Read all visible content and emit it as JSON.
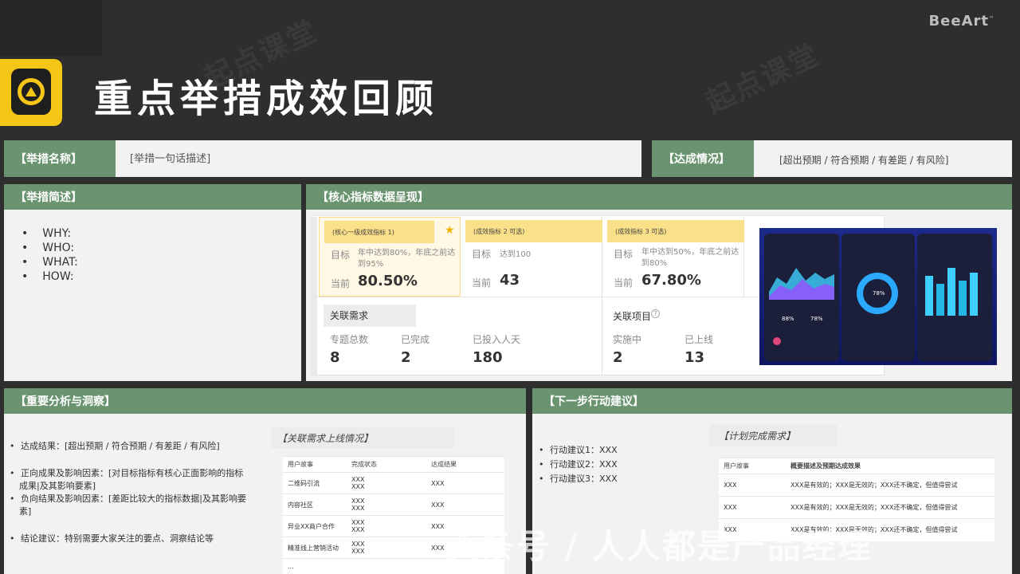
{
  "brand": "BeeArt",
  "brand_mark": "™",
  "page_title": "重点举措成效回顾",
  "top": {
    "name_label": "【举措名称】",
    "name_value": "[举措一句话描述]",
    "status_label": "【达成情况】",
    "status_value": "[超出预期 / 符合预期 / 有差距 / 有风险]"
  },
  "summary": {
    "title": "【举措简述】",
    "items": [
      "WHY:",
      "WHO:",
      "WHAT:",
      "HOW:"
    ]
  },
  "metrics": {
    "title": "【核心指标数据呈现】",
    "cards": [
      {
        "tag": "(核心一级成效指标 1)",
        "target_label": "目标",
        "target": "年中达到80%，年底之前达到95%",
        "current_label": "当前",
        "current": "80.50%"
      },
      {
        "tag": "(成效指标 2 可选)",
        "target_label": "目标",
        "target": "达到100",
        "current_label": "当前",
        "current": "43"
      },
      {
        "tag": "(成效指标 3 可选)",
        "target_label": "目标",
        "target": "年中达到50%，年底之前达到80%",
        "current_label": "当前",
        "current": "67.80%"
      }
    ],
    "related_demand": {
      "title": "关联需求",
      "stats": [
        {
          "label": "专题总数",
          "value": "8"
        },
        {
          "label": "已完成",
          "value": "2"
        },
        {
          "label": "已投入人天",
          "value": "180"
        }
      ]
    },
    "related_project": {
      "title": "关联项目",
      "stats": [
        {
          "label": "实施中",
          "value": "2"
        },
        {
          "label": "已上线",
          "value": "13"
        }
      ]
    },
    "phone_values": [
      "88%",
      "78%",
      "78%"
    ]
  },
  "analysis": {
    "title": "【重要分析与洞察】",
    "points": [
      "达成结果：[超出预期 / 符合预期 / 有差距 / 有风险]",
      "正向成果及影响因素：[对目标指标有核心正面影响的指标成果|及其影响要素]",
      "负向结果及影响因素：[差距比较大的指标数据|及其影响要素]",
      "结论建议：特别需要大家关注的要点、洞察结论等"
    ],
    "table_title": "【关联需求上线情况】",
    "table_headers": [
      "用户故事",
      "完成状态",
      "达成结果"
    ],
    "table_rows": [
      [
        "二维码引流",
        "XXX\nXXX",
        "XXX"
      ],
      [
        "内容社区",
        "XXX\nXXX",
        "XXX"
      ],
      [
        "异业XX商户合作",
        "XXX\nXXX",
        "XXX"
      ],
      [
        "精准线上营销活动",
        "XXX\nXXX",
        "XXX"
      ],
      [
        "...",
        "",
        ""
      ]
    ]
  },
  "next": {
    "title": "【下一步行动建议】",
    "items": [
      "行动建议1：XXX",
      "行动建议2：XXX",
      "行动建议3：XXX"
    ],
    "table_title": "【计划完成需求】",
    "table_headers": [
      "用户故事",
      "概要描述及预期达成效果"
    ],
    "table_rows": [
      [
        "XXX",
        "XXX是有效的；XXX是无效的；XXX还不确定，但值得尝试"
      ],
      [
        "XXX",
        "XXX是有效的；XXX是无效的；XXX还不确定，但值得尝试"
      ],
      [
        "XXX",
        "XXX是有效的；XXX是无效的；XXX还不确定，但值得尝试"
      ]
    ]
  },
  "watermark_bottom": "头条号 / 人人都是产品经理",
  "watermark_top": [
    "起点课堂",
    "起点课堂"
  ],
  "colors": {
    "accent_green": "#6a946f",
    "tag_yellow": "#fbe08a",
    "logo_yellow": "#f5c518",
    "bg_dark": "#2e2e2e"
  }
}
